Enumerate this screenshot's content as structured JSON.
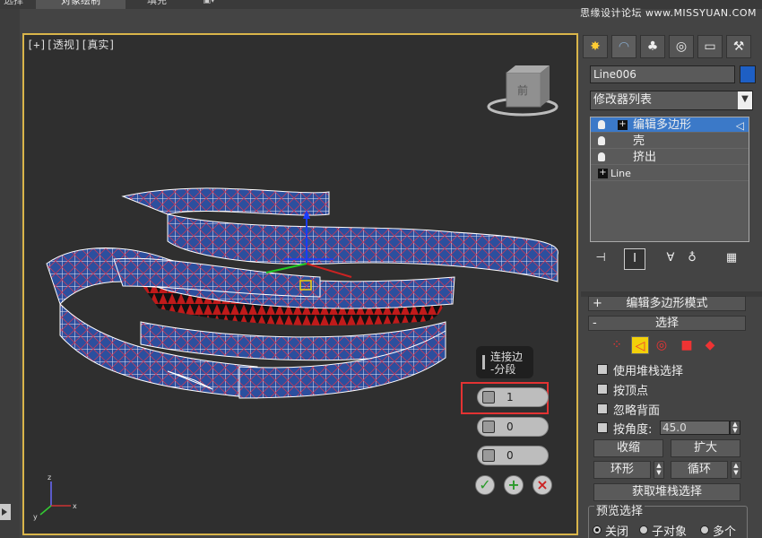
{
  "top_tabs": [
    {
      "label": "选择"
    },
    {
      "label": "对象绘制"
    },
    {
      "label": "填充"
    }
  ],
  "watermark": "思缘设计论坛 www.MISSYUAN.COM",
  "viewport": {
    "label": "[+][透视][真实]",
    "viewcube_label": "前"
  },
  "caddy": {
    "title_line1": "连接边",
    "title_line2": "-分段",
    "fields": [
      {
        "value": "1"
      },
      {
        "value": "0"
      },
      {
        "value": "0"
      }
    ],
    "buttons": {
      "ok": "✓",
      "apply": "+",
      "cancel": "×"
    }
  },
  "panel": {
    "object_name": "Line006",
    "object_color": "#1e5fc4",
    "modifier_list_label": "修改器列表",
    "stack": [
      {
        "label": "编辑多边形",
        "selected": true
      },
      {
        "label": "壳",
        "selected": false
      },
      {
        "label": "挤出",
        "selected": false
      },
      {
        "label": "Line",
        "selected": false
      }
    ],
    "rollout_mode": {
      "sign": "+",
      "title": "编辑多边形模式"
    },
    "rollout_select": {
      "sign": "-",
      "title": "选择"
    },
    "checkboxes": {
      "use_stack": "使用堆栈选择",
      "by_vertex": "按顶点",
      "ignore_back": "忽略背面",
      "by_angle": "按角度:"
    },
    "angle_value": "45.0",
    "buttons": {
      "shrink": "收缩",
      "grow": "扩大",
      "ring": "环形",
      "loop": "循环",
      "get_stack": "获取堆栈选择"
    },
    "preview": {
      "title": "预览选择",
      "off": "关闭",
      "subobject": "子对象",
      "multi": "多个"
    }
  },
  "colors": {
    "viewport_border": "#d9b54a",
    "highlight": "#e33333",
    "selection": "#3b79c8"
  }
}
